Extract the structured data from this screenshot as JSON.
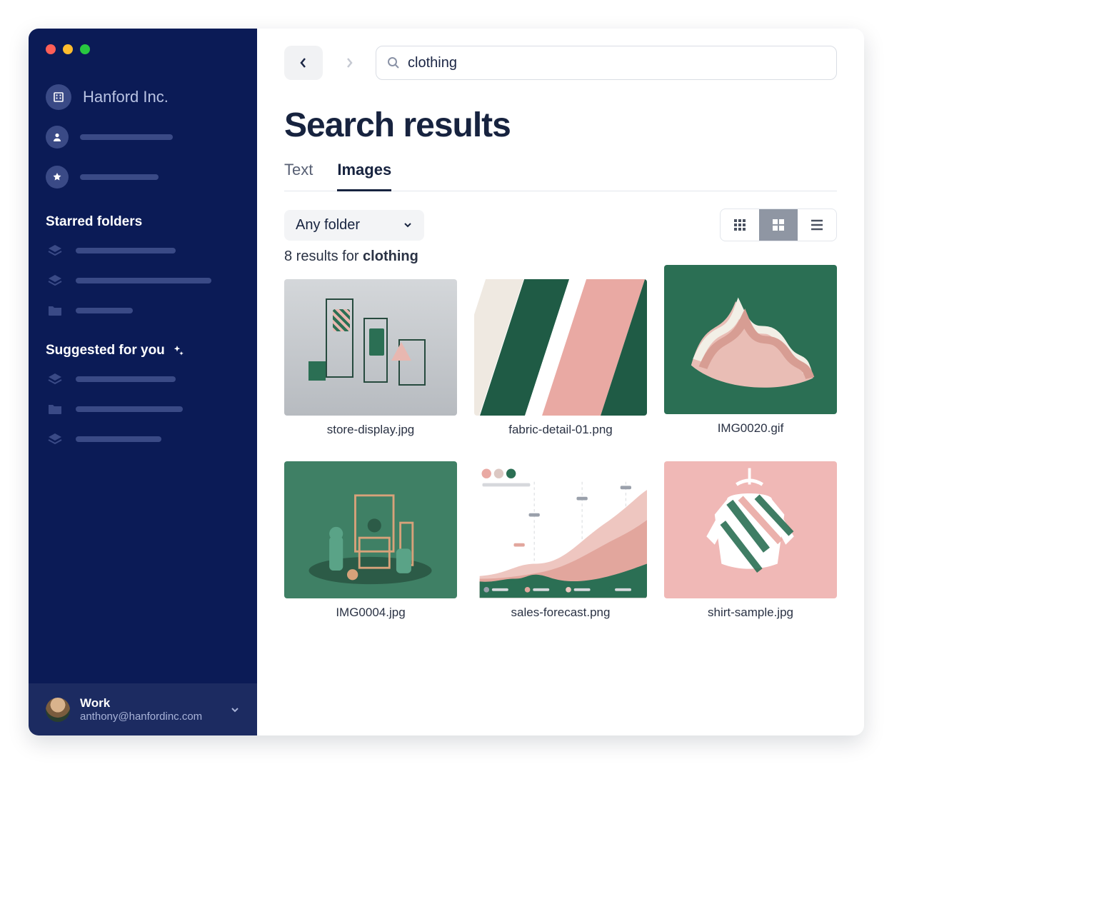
{
  "sidebar": {
    "org_name": "Hanford Inc.",
    "sections": {
      "starred": "Starred folders",
      "suggested": "Suggested for you"
    },
    "footer": {
      "workspace": "Work",
      "email": "anthony@hanfordinc.com"
    }
  },
  "search": {
    "query": "clothing"
  },
  "page": {
    "title": "Search results",
    "tabs": [
      "Text",
      "Images"
    ],
    "active_tab": 1,
    "folder_filter": "Any folder",
    "results_count_prefix": "8 results for ",
    "results_term": "clothing"
  },
  "results": [
    {
      "filename": "store-display.jpg"
    },
    {
      "filename": "fabric-detail-01.png"
    },
    {
      "filename": "IMG0020.gif"
    },
    {
      "filename": "IMG0004.jpg"
    },
    {
      "filename": "sales-forecast.png"
    },
    {
      "filename": "shirt-sample.jpg"
    }
  ]
}
